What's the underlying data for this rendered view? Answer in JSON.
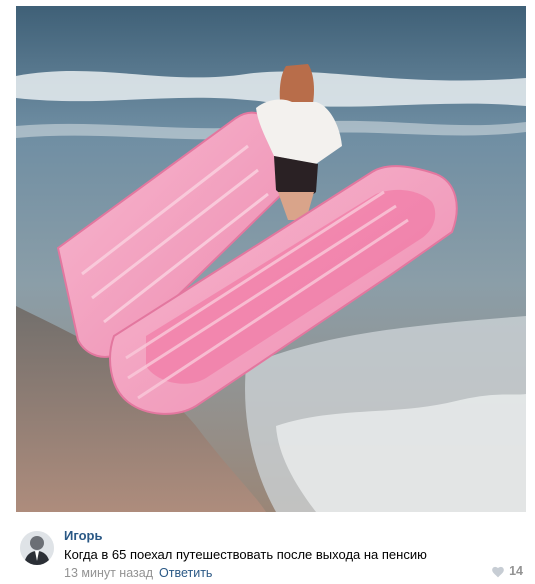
{
  "post": {
    "photo_icon": "photo-inflatable-pink-coffin-beach",
    "comment": {
      "author": "Игорь",
      "text": "Когда в 65 поехал путешествовать после выхода на пенсию",
      "time": "13 минут назад",
      "reply_label": "Ответить",
      "likes": "14",
      "like_icon": "heart-icon",
      "colors": {
        "link": "#2a5885",
        "meta": "#939393"
      }
    }
  }
}
